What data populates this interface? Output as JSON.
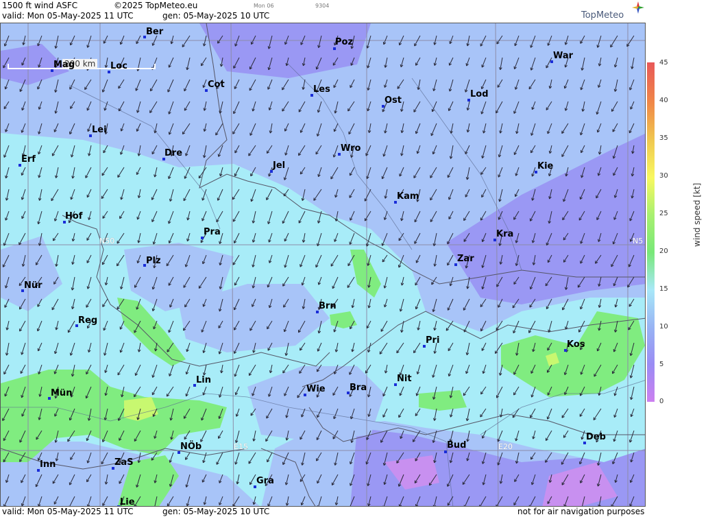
{
  "header": {
    "title": "1500 ft wind ASFC",
    "copyright": "©2025 TopMeteo.eu",
    "valid": "valid:  Mon  05-May-2025  11 UTC",
    "gen": "gen:  05-May-2025 10 UTC",
    "mini1": "Mon 06",
    "mini2": "9304",
    "logo": "TopMeteo"
  },
  "footer": {
    "valid": "valid:  Mon  05-May-2025  11 UTC",
    "gen": "gen:  05-May-2025 10 UTC",
    "note": "not for air navigation purposes"
  },
  "scale_label": "200 km",
  "grid_labels": {
    "n50": "N50",
    "e15": "E15",
    "e20": "E20",
    "n5": "N5"
  },
  "legend": {
    "title": "wind  speed  [kt]",
    "ticks": [
      "45",
      "40",
      "35",
      "30",
      "25",
      "20",
      "15",
      "10",
      "5",
      "0"
    ],
    "colors": {
      "low": "#cc80f0",
      "mid": "#a8e8f8",
      "green": "#78e878",
      "high": "#e85858"
    }
  },
  "cities": {
    "ber": "Ber",
    "poz": "Poz",
    "war": "War",
    "mag": "Mag",
    "loc": "Loc",
    "cot": "Cot",
    "les": "Les",
    "ost": "Ost",
    "lod": "Lod",
    "lei": "Lei",
    "dre": "Dre",
    "wro": "Wro",
    "erf": "Erf",
    "jel": "Jel",
    "kie": "Kie",
    "kam": "Kam",
    "hof": "Hof",
    "pra": "Pra",
    "kra": "Kra",
    "zar": "Zar",
    "plz": "Plz",
    "nur": "Nür",
    "brn": "Brn",
    "reg": "Reg",
    "pri": "Pri",
    "kos": "Kos",
    "lin": "Lin",
    "nit": "Nit",
    "mun": "Mün",
    "wie": "Wie",
    "bra": "Bra",
    "deb": "Deb",
    "nob": "NÖb",
    "bud": "Bud",
    "inn": "Inn",
    "zas": "ZaS",
    "gra": "Gra",
    "lie": "Lie"
  },
  "wind_direction": "north-northeast"
}
